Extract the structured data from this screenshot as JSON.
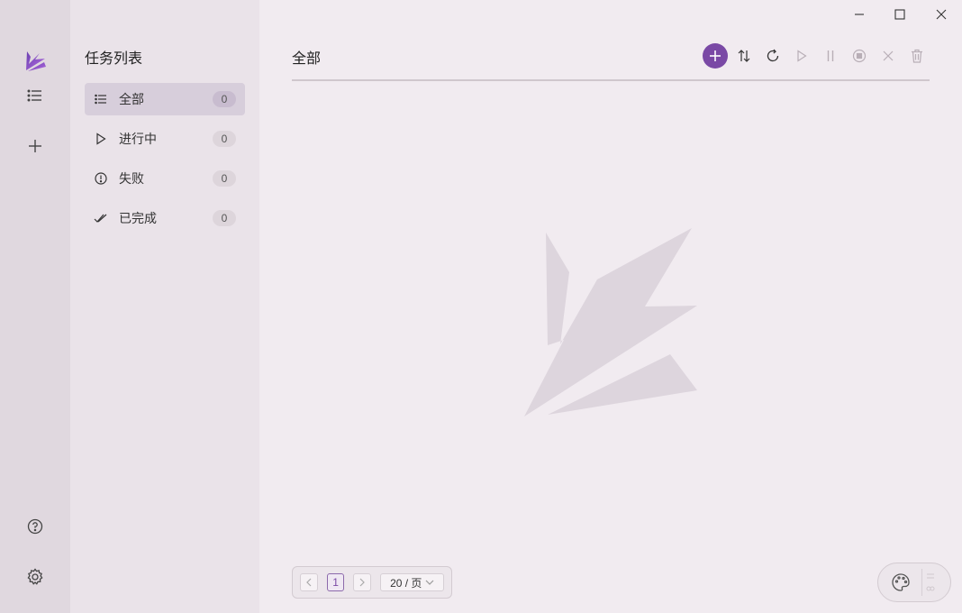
{
  "sidebar": {
    "title": "任务列表",
    "items": [
      {
        "label": "全部",
        "count": "0"
      },
      {
        "label": "进行中",
        "count": "0"
      },
      {
        "label": "失败",
        "count": "0"
      },
      {
        "label": "已完成",
        "count": "0"
      }
    ]
  },
  "main": {
    "title": "全部"
  },
  "pagination": {
    "prev": "<",
    "current_page": "1",
    "next": ">",
    "page_size": "20 / 页"
  },
  "colors": {
    "accent": "#7a49a5",
    "sidebar_bg": "#eae3e9",
    "rail_bg": "#e0d8df",
    "main_bg": "#f1ebf0"
  }
}
